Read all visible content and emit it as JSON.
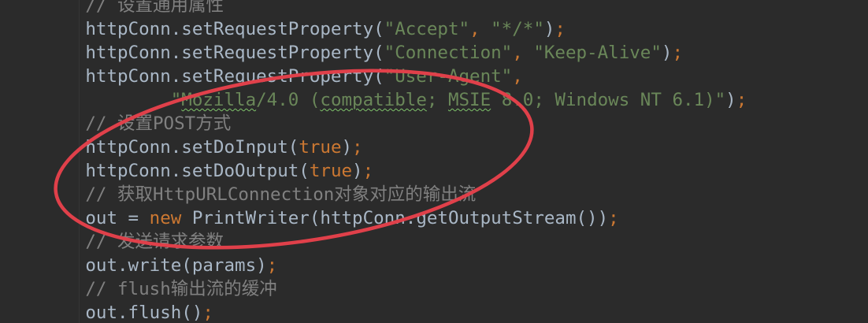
{
  "editor": {
    "lines": [
      {
        "ind": "        ",
        "segs": [
          {
            "t": "// 设置通用属性",
            "c": "cm"
          }
        ]
      },
      {
        "ind": "        ",
        "segs": [
          {
            "t": "httpConn.setRequestProperty(",
            "c": "pl"
          },
          {
            "t": "\"Accept\"",
            "c": "str"
          },
          {
            "t": ", ",
            "c": "kw"
          },
          {
            "t": "\"*/*\"",
            "c": "str"
          },
          {
            "t": ")",
            "c": "pl"
          },
          {
            "t": ";",
            "c": "kw"
          }
        ]
      },
      {
        "ind": "        ",
        "segs": [
          {
            "t": "httpConn.setRequestProperty(",
            "c": "pl"
          },
          {
            "t": "\"Connection\"",
            "c": "str"
          },
          {
            "t": ", ",
            "c": "kw"
          },
          {
            "t": "\"Keep-Alive\"",
            "c": "str"
          },
          {
            "t": ")",
            "c": "pl"
          },
          {
            "t": ";",
            "c": "kw"
          }
        ]
      },
      {
        "ind": "        ",
        "segs": [
          {
            "t": "httpConn.setRequestProperty(",
            "c": "pl"
          },
          {
            "t": "\"User-Agent\"",
            "c": "str"
          },
          {
            "t": ",",
            "c": "kw"
          }
        ]
      },
      {
        "ind": "                ",
        "segs": [
          {
            "t": "\"",
            "c": "str"
          },
          {
            "t": "Mozilla",
            "c": "str sq"
          },
          {
            "t": "/4.0 (",
            "c": "str"
          },
          {
            "t": "compatible",
            "c": "str sq"
          },
          {
            "t": "; ",
            "c": "str"
          },
          {
            "t": "MSIE",
            "c": "str sq"
          },
          {
            "t": " 8.0; Windows NT 6.1)\"",
            "c": "str"
          },
          {
            "t": ")",
            "c": "pl"
          },
          {
            "t": ";",
            "c": "kw"
          }
        ]
      },
      {
        "ind": "        ",
        "segs": [
          {
            "t": "// 设置POST方式",
            "c": "cm"
          }
        ]
      },
      {
        "ind": "        ",
        "segs": [
          {
            "t": "httpConn.setDoInput(",
            "c": "pl"
          },
          {
            "t": "true",
            "c": "kw"
          },
          {
            "t": ")",
            "c": "pl"
          },
          {
            "t": ";",
            "c": "kw"
          }
        ]
      },
      {
        "ind": "        ",
        "segs": [
          {
            "t": "httpConn.setDoOutput(",
            "c": "pl"
          },
          {
            "t": "true",
            "c": "kw"
          },
          {
            "t": ")",
            "c": "pl"
          },
          {
            "t": ";",
            "c": "kw"
          }
        ]
      },
      {
        "ind": "        ",
        "segs": [
          {
            "t": "// 获取HttpURLConnection对象对应的输出流",
            "c": "cm"
          }
        ]
      },
      {
        "ind": "        ",
        "segs": [
          {
            "t": "out = ",
            "c": "pl"
          },
          {
            "t": "new ",
            "c": "kw"
          },
          {
            "t": "PrintWriter(httpConn.getOutputStream())",
            "c": "pl"
          },
          {
            "t": ";",
            "c": "kw"
          }
        ]
      },
      {
        "ind": "        ",
        "segs": [
          {
            "t": "// 发送请求参数",
            "c": "cm"
          }
        ]
      },
      {
        "ind": "        ",
        "segs": [
          {
            "t": "out.write(params)",
            "c": "pl"
          },
          {
            "t": ";",
            "c": "kw"
          }
        ]
      },
      {
        "ind": "        ",
        "segs": [
          {
            "t": "// flush输出流的缓冲",
            "c": "cm"
          }
        ]
      },
      {
        "ind": "        ",
        "segs": [
          {
            "t": "out.flush()",
            "c": "pl"
          },
          {
            "t": ";",
            "c": "kw"
          }
        ]
      }
    ]
  },
  "colors": {
    "background": "#2b2b2b",
    "plain": "#a9b7c6",
    "comment": "#808080",
    "string": "#6a8759",
    "keyword": "#cc7832",
    "annotation_ellipse": "#e0404a",
    "spellcheck_underline": "#7ec26a"
  }
}
